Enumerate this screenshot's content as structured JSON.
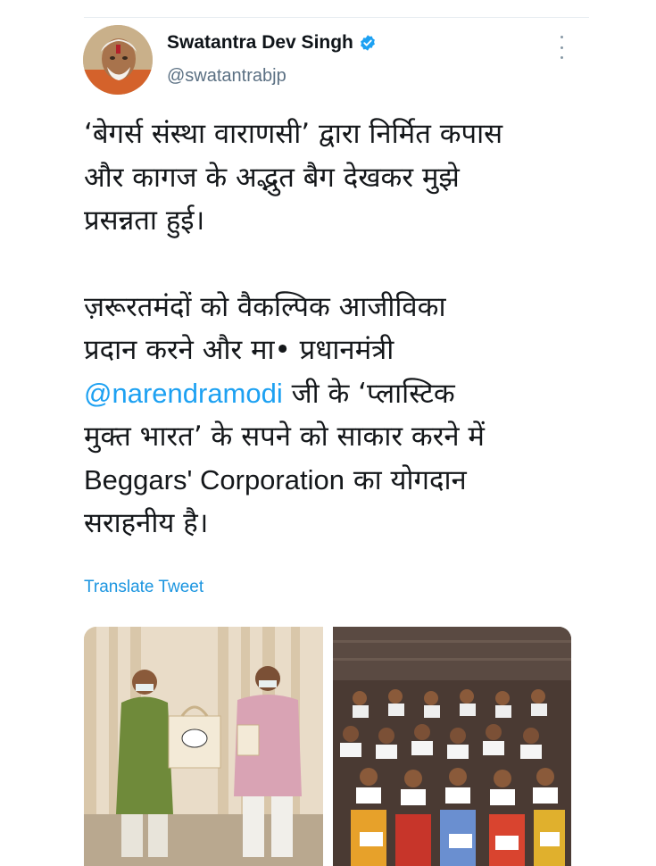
{
  "author": {
    "name": "Swatantra Dev Singh",
    "handle": "@swatantrabjp",
    "verified": true,
    "avatar_icon": "profile-photo"
  },
  "tweet": {
    "line_1": "‘बेगर्स संस्था वाराणसी’ द्वारा निर्मित कपास",
    "line_2": "और कागज के अद्भुत बैग देखकर मुझे",
    "line_3": "प्रसन्नता हुई।",
    "line_4": "ज़रूरतमंदों को वैकल्पिक आजीविका",
    "line_5": "प्रदान करने और मा• प्रधानमंत्री",
    "mention": "@narendramodi",
    "line_6_rest": " जी के ‘प्लास्टिक",
    "line_7": "मुक्त भारत’ के सपने को साकार करने में",
    "brand": "Beggars' Corporation",
    "line_8_rest": " का योगदान",
    "line_9": "सराहनीय है।"
  },
  "translate_label": "Translate Tweet",
  "media": {
    "left_icon": "photo-two-men-holding-bags",
    "right_icon": "photo-group-with-certificates"
  },
  "colors": {
    "link": "#1da1f2",
    "translate": "#1b95e0",
    "verified": "#1da1f2",
    "secondary_text": "#5b7083"
  }
}
